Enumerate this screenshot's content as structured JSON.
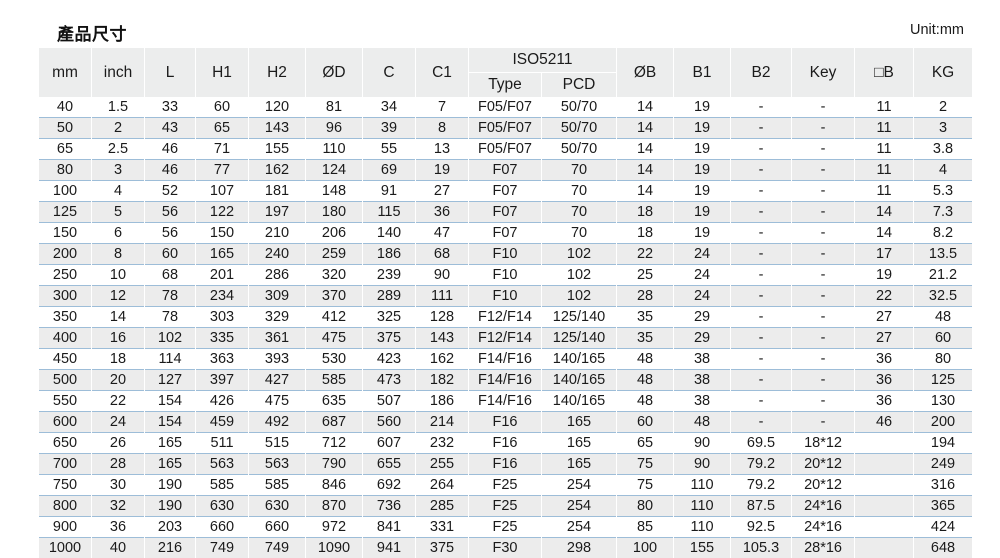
{
  "header": {
    "title": "產品尺寸",
    "unit_note": "Unit:mm"
  },
  "table": {
    "group_header": {
      "iso_label": "ISO5211"
    },
    "columns": [
      {
        "key": "mm",
        "label": "mm"
      },
      {
        "key": "inch",
        "label": "inch"
      },
      {
        "key": "L",
        "label": "L"
      },
      {
        "key": "H1",
        "label": "H1"
      },
      {
        "key": "H2",
        "label": "H2"
      },
      {
        "key": "OD",
        "label": "ØD"
      },
      {
        "key": "C",
        "label": "C"
      },
      {
        "key": "C1",
        "label": "C1"
      },
      {
        "key": "Type",
        "label": "Type"
      },
      {
        "key": "PCD",
        "label": "PCD"
      },
      {
        "key": "OB",
        "label": "ØB"
      },
      {
        "key": "B1",
        "label": "B1"
      },
      {
        "key": "B2",
        "label": "B2"
      },
      {
        "key": "Key",
        "label": "Key"
      },
      {
        "key": "SQB",
        "label": "□B"
      },
      {
        "key": "KG",
        "label": "KG"
      }
    ],
    "rows": [
      [
        "40",
        "1.5",
        "33",
        "60",
        "120",
        "81",
        "34",
        "7",
        "F05/F07",
        "50/70",
        "14",
        "19",
        "-",
        "-",
        "11",
        "2"
      ],
      [
        "50",
        "2",
        "43",
        "65",
        "143",
        "96",
        "39",
        "8",
        "F05/F07",
        "50/70",
        "14",
        "19",
        "-",
        "-",
        "11",
        "3"
      ],
      [
        "65",
        "2.5",
        "46",
        "71",
        "155",
        "110",
        "55",
        "13",
        "F05/F07",
        "50/70",
        "14",
        "19",
        "-",
        "-",
        "11",
        "3.8"
      ],
      [
        "80",
        "3",
        "46",
        "77",
        "162",
        "124",
        "69",
        "19",
        "F07",
        "70",
        "14",
        "19",
        "-",
        "-",
        "11",
        "4"
      ],
      [
        "100",
        "4",
        "52",
        "107",
        "181",
        "148",
        "91",
        "27",
        "F07",
        "70",
        "14",
        "19",
        "-",
        "-",
        "11",
        "5.3"
      ],
      [
        "125",
        "5",
        "56",
        "122",
        "197",
        "180",
        "115",
        "36",
        "F07",
        "70",
        "18",
        "19",
        "-",
        "-",
        "14",
        "7.3"
      ],
      [
        "150",
        "6",
        "56",
        "150",
        "210",
        "206",
        "140",
        "47",
        "F07",
        "70",
        "18",
        "19",
        "-",
        "-",
        "14",
        "8.2"
      ],
      [
        "200",
        "8",
        "60",
        "165",
        "240",
        "259",
        "186",
        "68",
        "F10",
        "102",
        "22",
        "24",
        "-",
        "-",
        "17",
        "13.5"
      ],
      [
        "250",
        "10",
        "68",
        "201",
        "286",
        "320",
        "239",
        "90",
        "F10",
        "102",
        "25",
        "24",
        "-",
        "-",
        "19",
        "21.2"
      ],
      [
        "300",
        "12",
        "78",
        "234",
        "309",
        "370",
        "289",
        "111",
        "F10",
        "102",
        "28",
        "24",
        "-",
        "-",
        "22",
        "32.5"
      ],
      [
        "350",
        "14",
        "78",
        "303",
        "329",
        "412",
        "325",
        "128",
        "F12/F14",
        "125/140",
        "35",
        "29",
        "-",
        "-",
        "27",
        "48"
      ],
      [
        "400",
        "16",
        "102",
        "335",
        "361",
        "475",
        "375",
        "143",
        "F12/F14",
        "125/140",
        "35",
        "29",
        "-",
        "-",
        "27",
        "60"
      ],
      [
        "450",
        "18",
        "114",
        "363",
        "393",
        "530",
        "423",
        "162",
        "F14/F16",
        "140/165",
        "48",
        "38",
        "-",
        "-",
        "36",
        "80"
      ],
      [
        "500",
        "20",
        "127",
        "397",
        "427",
        "585",
        "473",
        "182",
        "F14/F16",
        "140/165",
        "48",
        "38",
        "-",
        "-",
        "36",
        "125"
      ],
      [
        "550",
        "22",
        "154",
        "426",
        "475",
        "635",
        "507",
        "186",
        "F14/F16",
        "140/165",
        "48",
        "38",
        "-",
        "-",
        "36",
        "130"
      ],
      [
        "600",
        "24",
        "154",
        "459",
        "492",
        "687",
        "560",
        "214",
        "F16",
        "165",
        "60",
        "48",
        "-",
        "-",
        "46",
        "200"
      ],
      [
        "650",
        "26",
        "165",
        "511",
        "515",
        "712",
        "607",
        "232",
        "F16",
        "165",
        "65",
        "90",
        "69.5",
        "18*12",
        "",
        "194"
      ],
      [
        "700",
        "28",
        "165",
        "563",
        "563",
        "790",
        "655",
        "255",
        "F16",
        "165",
        "75",
        "90",
        "79.2",
        "20*12",
        "",
        "249"
      ],
      [
        "750",
        "30",
        "190",
        "585",
        "585",
        "846",
        "692",
        "264",
        "F25",
        "254",
        "75",
        "110",
        "79.2",
        "20*12",
        "",
        "316"
      ],
      [
        "800",
        "32",
        "190",
        "630",
        "630",
        "870",
        "736",
        "285",
        "F25",
        "254",
        "80",
        "110",
        "87.5",
        "24*16",
        "",
        "365"
      ],
      [
        "900",
        "36",
        "203",
        "660",
        "660",
        "972",
        "841",
        "331",
        "F25",
        "254",
        "85",
        "110",
        "92.5",
        "24*16",
        "",
        "424"
      ],
      [
        "1000",
        "40",
        "216",
        "749",
        "749",
        "1090",
        "941",
        "375",
        "F30",
        "298",
        "100",
        "155",
        "105.3",
        "28*16",
        "",
        "648"
      ]
    ]
  },
  "colors": {
    "header_bg": "#eceded",
    "row_alt_bg": "#ececec",
    "rule_blue": "#9dbdd8",
    "text": "#1a1a1a"
  }
}
